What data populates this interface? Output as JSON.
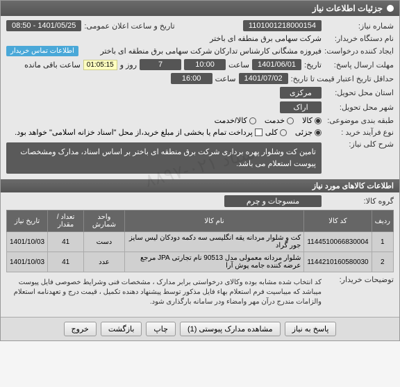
{
  "header": {
    "title": "جزئیات اطلاعات نیاز"
  },
  "fields": {
    "need_no_label": "شماره نیاز:",
    "need_no": "1101001218000154",
    "announce_label": "تاریخ و ساعت اعلان عمومی:",
    "announce_val": "1401/05/25 - 08:50",
    "buyer_label": "نام دستگاه خریدار:",
    "buyer_val": "شرکت سهامی برق منطقه ای باختر",
    "requester_label": "ایجاد کننده درخواست:",
    "requester_val": "فیروزه مشگانی کارشناس تدارکان شرکت سهامی برق منطقه ای باختر",
    "contact_badge": "اطلاعات تماس خریدار",
    "deadline_label": "مهلت ارسال پاسخ:",
    "deadline_date_label": "تاریخ:",
    "deadline_date": "1401/06/01",
    "deadline_time_label": "ساعت",
    "deadline_time": "10:00",
    "days_label": "روز و",
    "days_val": "7",
    "countdown": "01:05:15",
    "remaining_label": "ساعت باقی مانده",
    "validity_label": "حداقل تاریخ اعتبار قیمت تا تاریخ:",
    "validity_date": "1401/07/02",
    "validity_time": "16:00",
    "province_label": "استان محل تحویل:",
    "province_val": "مرکزی",
    "city_label": "شهر محل تحویل:",
    "city_val": "اراک",
    "category_label": "طبقه بندی موضوعی:",
    "cat_goods": "کالا",
    "cat_services": "خدمت",
    "cat_both": "کالا/خدمت",
    "process_label": "نوع فرآیند خرید :",
    "process_partial": "جزئی",
    "process_total": "کلی",
    "process_note": "پرداخت تمام یا بخشی از مبلغ خرید،از محل \"اسناد خزانه اسلامی\" خواهد بود.",
    "summary_label": "شرح کلی نیاز:",
    "summary_text": "تامین کت وشلوار پهره برداری شرکت برق منطقه ای باختر بر اساس اسناد، مدارک ومشخصات پیوست استعلام می باشد.",
    "goods_section": "اطلاعات کالاهای مورد نیاز",
    "group_label": "گروه کالا:",
    "group_val": "منسوجات و چرم",
    "buyer_notes_label": "توضیحات خریدار:",
    "buyer_notes": "کد انتخاب شده مشابه بوده وکالای درخواستی برابر مدارک ، مشخصات فنی وشرایط خصوصی فایل پیوست میباشد که میباسیت فرم استعلام بهاء فایل مذکور توسط پیشنهاد دهنده تکمیل ، قیمت درج و تعهدنامه استعلام والزامات مندرج درآن مهر وامضاء ودر سامانه بارگذاری شود."
  },
  "table": {
    "headers": {
      "row": "ردیف",
      "code": "کد کالا",
      "name": "نام کالا",
      "unit": "واحد شمارش",
      "qty": "تعداد / مقدار",
      "date": "تاریخ نیاز"
    },
    "rows": [
      {
        "n": "1",
        "code": "1144510066830004",
        "name": "کت و شلوار مردانه یقه انگلیسی سه دکمه دودکان لیس سایز جور گراد",
        "unit": "دست",
        "qty": "41",
        "date": "1401/10/03"
      },
      {
        "n": "2",
        "code": "1144210160580030",
        "name": "شلوار مردانه معمولی مدل 90513 نام تجارتی JPA مرجع عرضه کننده جامه پوش آرا",
        "unit": "عدد",
        "qty": "41",
        "date": "1401/10/03"
      }
    ]
  },
  "buttons": {
    "reply": "پاسخ به نیاز",
    "attachments": "مشاهده مدارک پیوستی (1)",
    "print": "چاپ",
    "back": "بازگشت",
    "exit": "خروج"
  },
  "watermark": "ستاد ۰۲۱-۸۸۹۷"
}
